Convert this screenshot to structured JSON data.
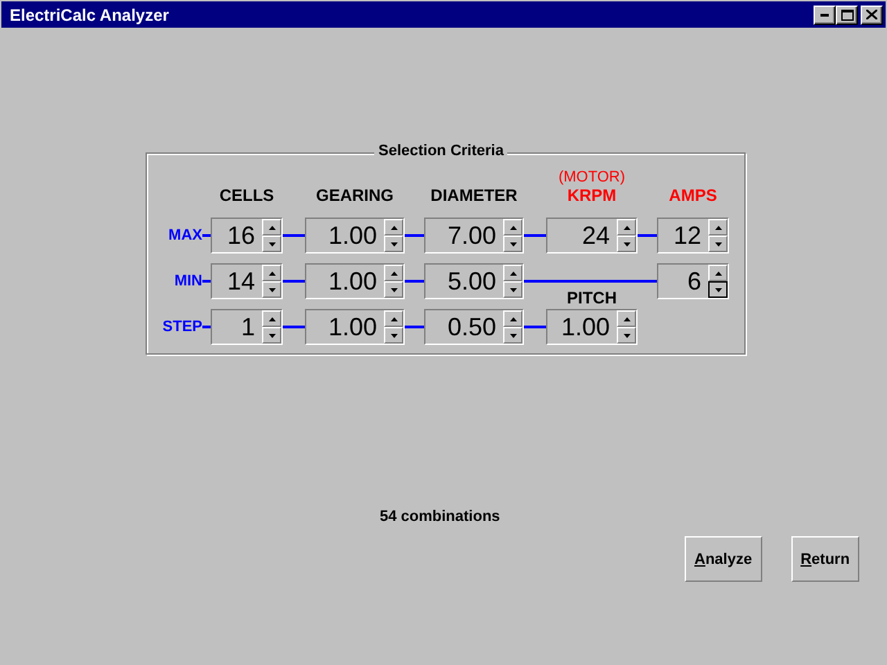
{
  "window": {
    "title": "ElectriCalc Analyzer"
  },
  "selection_criteria": {
    "title": "Selection Criteria",
    "columns": [
      {
        "label": "CELLS",
        "color": "#000000"
      },
      {
        "label": "GEARING",
        "color": "#000000"
      },
      {
        "label": "DIAMETER",
        "color": "#000000"
      },
      {
        "label": "KRPM",
        "note": "(MOTOR)",
        "color": "#ff0000"
      },
      {
        "label": "AMPS",
        "color": "#ff0000"
      }
    ],
    "rows": [
      {
        "label": "MAX",
        "cells": [
          {
            "kind": "spinner",
            "value": "16",
            "focused": false
          },
          {
            "kind": "spinner",
            "value": "1.00",
            "focused": false
          },
          {
            "kind": "spinner",
            "value": "7.00",
            "focused": false
          },
          {
            "kind": "spinner",
            "value": "24",
            "focused": false
          },
          {
            "kind": "spinner",
            "value": "12",
            "focused": false
          }
        ]
      },
      {
        "label": "MIN",
        "cells": [
          {
            "kind": "spinner",
            "value": "14",
            "focused": false
          },
          {
            "kind": "spinner",
            "value": "1.00",
            "focused": false
          },
          {
            "kind": "spinner",
            "value": "5.00",
            "focused": false
          },
          {
            "kind": "line",
            "caption": "PITCH"
          },
          {
            "kind": "spinner",
            "value": "6",
            "focused": true
          }
        ]
      },
      {
        "label": "STEP",
        "cells": [
          {
            "kind": "spinner",
            "value": "1",
            "focused": false
          },
          {
            "kind": "spinner",
            "value": "1.00",
            "focused": false
          },
          {
            "kind": "spinner",
            "value": "0.50",
            "focused": false
          },
          {
            "kind": "spinner",
            "value": "1.00",
            "focused": false
          }
        ]
      }
    ]
  },
  "status": "54 combinations",
  "buttons": [
    {
      "label": "Analyze"
    },
    {
      "label": "Return"
    }
  ]
}
